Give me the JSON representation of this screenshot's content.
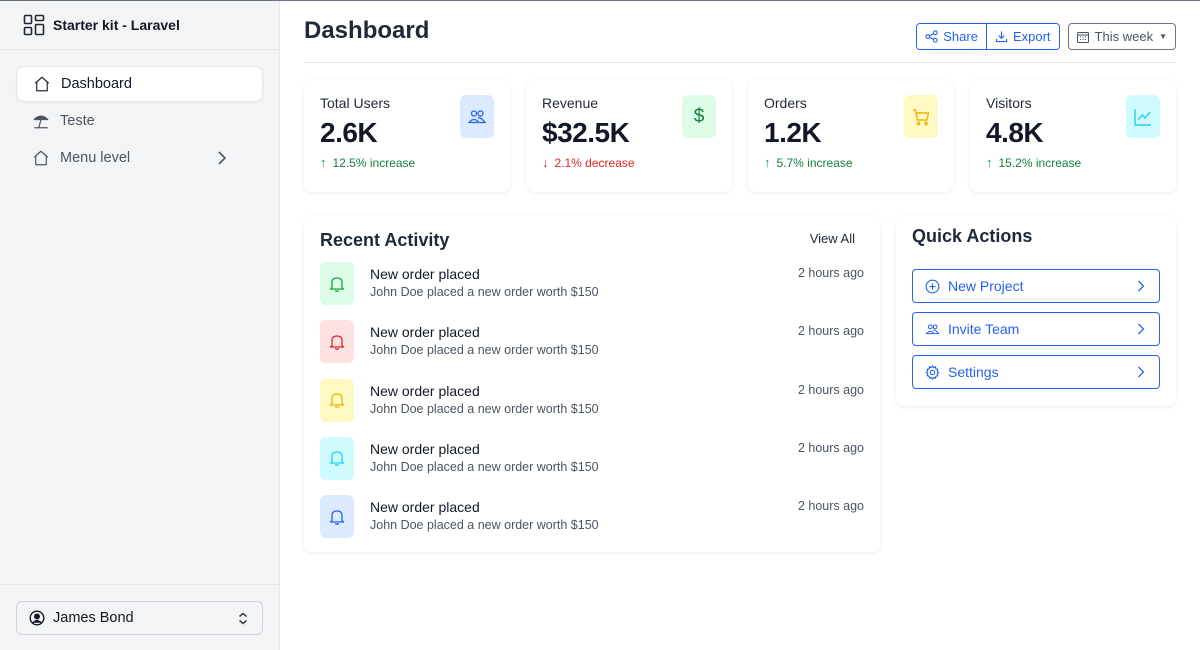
{
  "brand": {
    "title": "Starter kit - Laravel",
    "icon": "grid-icon"
  },
  "sidebar": {
    "items": [
      {
        "label": "Dashboard",
        "icon": "home-icon",
        "active": true
      },
      {
        "label": "Teste",
        "icon": "umbrella-icon",
        "active": false
      },
      {
        "label": "Menu level",
        "icon": "home-icon",
        "active": false,
        "has_children": true
      }
    ],
    "user": {
      "name": "James Bond",
      "icon": "user-circle-icon"
    }
  },
  "header": {
    "title": "Dashboard",
    "share_label": "Share",
    "export_label": "Export",
    "period_label": "This week"
  },
  "stats": [
    {
      "label": "Total Users",
      "value": "2.6K",
      "change": "12.5% increase",
      "trend": "up",
      "icon": "users-icon",
      "color": "#2563eb",
      "bg": "#dbeafe"
    },
    {
      "label": "Revenue",
      "value": "$32.5K",
      "change": "2.1% decrease",
      "trend": "down",
      "icon": "dollar-icon",
      "color": "#15803d",
      "bg": "#dcfce7"
    },
    {
      "label": "Orders",
      "value": "1.2K",
      "change": "5.7% increase",
      "trend": "up",
      "icon": "cart-icon",
      "color": "#eab308",
      "bg": "#fef9c3"
    },
    {
      "label": "Visitors",
      "value": "4.8K",
      "change": "15.2% increase",
      "trend": "up",
      "icon": "chart-line-icon",
      "color": "#22d3ee",
      "bg": "#cffafe"
    }
  ],
  "activity": {
    "title": "Recent Activity",
    "view_all": "View All",
    "items": [
      {
        "title": "New order placed",
        "desc": "John Doe placed a new order worth $150",
        "time": "2 hours ago",
        "color": "#16a34a",
        "bg": "#dcfce7"
      },
      {
        "title": "New order placed",
        "desc": "John Doe placed a new order worth $150",
        "time": "2 hours ago",
        "color": "#dc2626",
        "bg": "#fee2e2"
      },
      {
        "title": "New order placed",
        "desc": "John Doe placed a new order worth $150",
        "time": "2 hours ago",
        "color": "#eab308",
        "bg": "#fef9c3"
      },
      {
        "title": "New order placed",
        "desc": "John Doe placed a new order worth $150",
        "time": "2 hours ago",
        "color": "#22d3ee",
        "bg": "#cffafe"
      },
      {
        "title": "New order placed",
        "desc": "John Doe placed a new order worth $150",
        "time": "2 hours ago",
        "color": "#2563eb",
        "bg": "#dbeafe"
      }
    ]
  },
  "quick_actions": {
    "title": "Quick Actions",
    "items": [
      {
        "label": "New Project",
        "icon": "plus-circle-icon"
      },
      {
        "label": "Invite Team",
        "icon": "users-icon"
      },
      {
        "label": "Settings",
        "icon": "gear-icon"
      }
    ]
  }
}
